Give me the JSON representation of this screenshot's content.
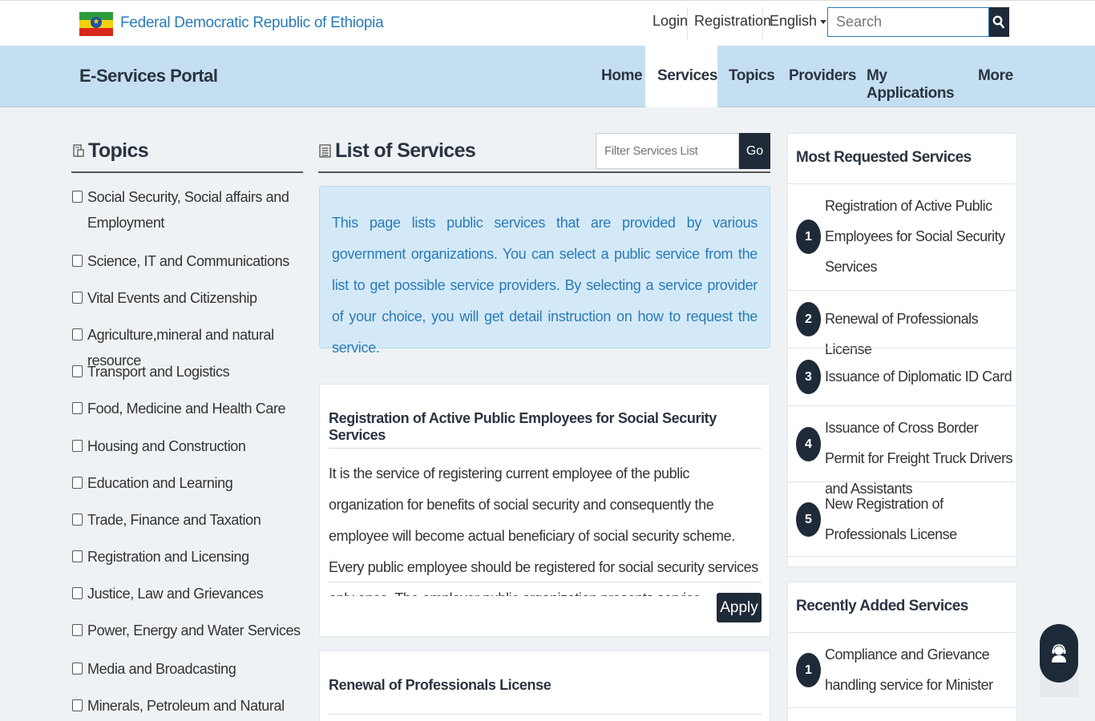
{
  "header": {
    "country": "Federal Democratic Republic of Ethiopia",
    "login": "Login",
    "registration": "Registration",
    "language": "English",
    "search_placeholder": "Search"
  },
  "nav": {
    "brand": "E-Services Portal",
    "items": [
      {
        "label": "Home",
        "active": false
      },
      {
        "label": "Services",
        "active": true
      },
      {
        "label": "Topics",
        "active": false
      },
      {
        "label": "Providers",
        "active": false
      },
      {
        "label": "My Applications",
        "active": false
      },
      {
        "label": "More",
        "active": false
      }
    ]
  },
  "topics": {
    "title": "Topics",
    "items": [
      {
        "label": "Social Security, Social affairs and Employment"
      },
      {
        "label": "Science, IT and Communications"
      },
      {
        "label": "Vital Events and Citizenship"
      },
      {
        "label": "Agriculture,mineral and natural resource"
      },
      {
        "label": "Transport and Logistics"
      },
      {
        "label": "Food, Medicine and Health Care"
      },
      {
        "label": "Housing and Construction"
      },
      {
        "label": "Education and Learning"
      },
      {
        "label": "Trade, Finance and Taxation"
      },
      {
        "label": "Registration and Licensing"
      },
      {
        "label": "Justice, Law and Grievances"
      },
      {
        "label": "Power, Energy and Water Services"
      },
      {
        "label": "Media and Broadcasting"
      },
      {
        "label": "Minerals, Petroleum and Natural Gas"
      }
    ]
  },
  "services": {
    "title": "List of Services",
    "filter_placeholder": "Filter Services List",
    "filter_button": "Go",
    "info": "This page lists public services that are provided by various government organizations. You can select a public service from the list to get possible service providers. By selecting a service provider of your choice, you will get detail instruction on how to request the service.",
    "cards": [
      {
        "title": "Registration of Active Public Employees for Social Security Services",
        "description": "It is the service of registering current employee of the public organization for benefits of social security and consequently the employee will become actual beneficiary of social security scheme. Every public employee should be registered for social security services only once. The employer public organization presents service",
        "apply": "Apply"
      },
      {
        "title": "Renewal of Professionals License"
      }
    ]
  },
  "most_requested": {
    "title": "Most Requested Services",
    "items": [
      {
        "num": "1",
        "label": "Registration of Active Public Employees for Social Security Services"
      },
      {
        "num": "2",
        "label": "Renewal of Professionals License"
      },
      {
        "num": "3",
        "label": "Issuance of Diplomatic ID Card"
      },
      {
        "num": "4",
        "label": "Issuance of Cross Border Permit for Freight Truck Drivers and Assistants"
      },
      {
        "num": "5",
        "label": "New Registration of Professionals License"
      }
    ]
  },
  "recently_added": {
    "title": "Recently Added Services",
    "items": [
      {
        "num": "1",
        "label": "Compliance and Grievance handling service for Minister"
      }
    ]
  },
  "icons": {
    "search": "search-icon",
    "chat": "support-agent-icon"
  },
  "colors": {
    "navbar_bg": "#c5dff2",
    "dark": "#1f2a38",
    "link_blue": "#2a7ab8",
    "info_bg": "#d4e9f7"
  }
}
